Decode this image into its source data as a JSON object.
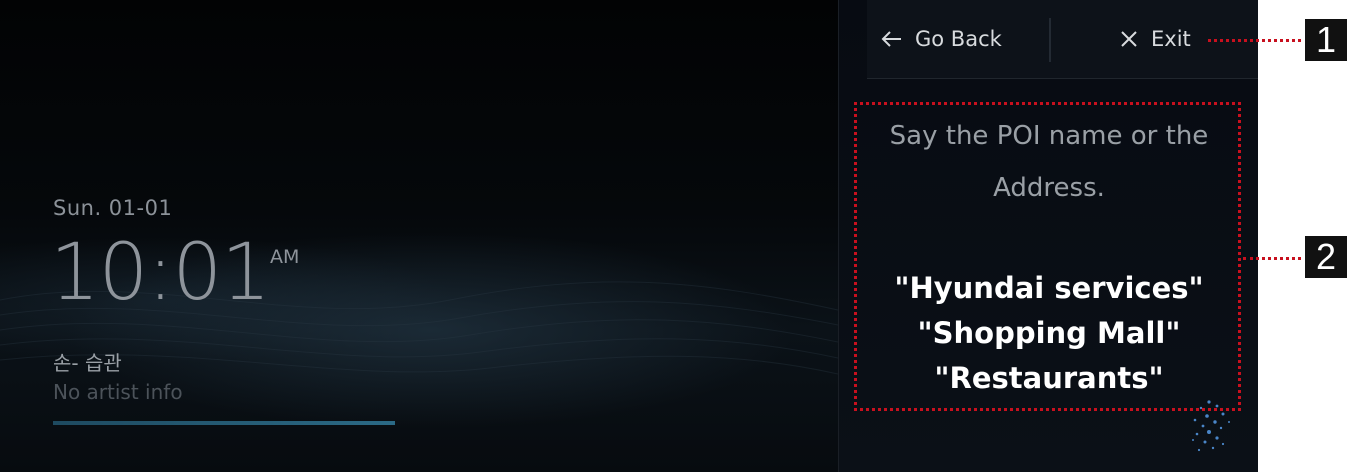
{
  "clock": {
    "date": "Sun. 01-01",
    "time": "10:01",
    "ampm": "AM"
  },
  "media": {
    "title": "손- 습관",
    "artist": "No artist info",
    "progress": 1.0
  },
  "voice_panel": {
    "go_back_label": "Go Back",
    "exit_label": "Exit",
    "prompt": "Say the POI name or the Address.",
    "examples": [
      "\"Hyundai services\"",
      "\"Shopping Mall\"",
      "\"Restaurants\""
    ]
  },
  "callouts": {
    "exit_number": "1",
    "content_number": "2",
    "color": "#c8101e"
  },
  "icons": {
    "back": "arrow-left-icon",
    "exit": "close-icon",
    "mic": "voice-particles-icon"
  }
}
